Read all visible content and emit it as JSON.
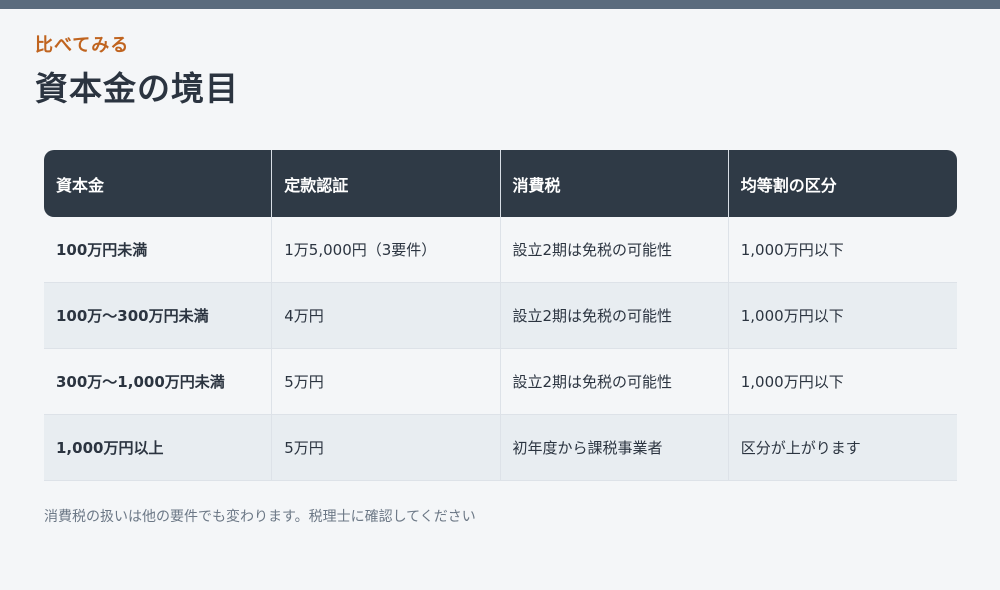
{
  "kicker": "比べてみる",
  "title": "資本金の境目",
  "table": {
    "headers": [
      "資本金",
      "定款認証",
      "消費税",
      "均等割の区分"
    ],
    "rows": [
      [
        "100万円未満",
        "1万5,000円（3要件）",
        "設立2期は免税の可能性",
        "1,000万円以下"
      ],
      [
        "100万〜300万円未満",
        "4万円",
        "設立2期は免税の可能性",
        "1,000万円以下"
      ],
      [
        "300万〜1,000万円未満",
        "5万円",
        "設立2期は免税の可能性",
        "1,000万円以下"
      ],
      [
        "1,000万円以上",
        "5万円",
        "初年度から課税事業者",
        "区分が上がります"
      ]
    ]
  },
  "note": "消費税の扱いは他の要件でも変わります。税理士に確認してください",
  "colors": {
    "accent": "#c0641f",
    "header_bg": "#2f3a46",
    "top_bar": "#5a6b7d"
  }
}
